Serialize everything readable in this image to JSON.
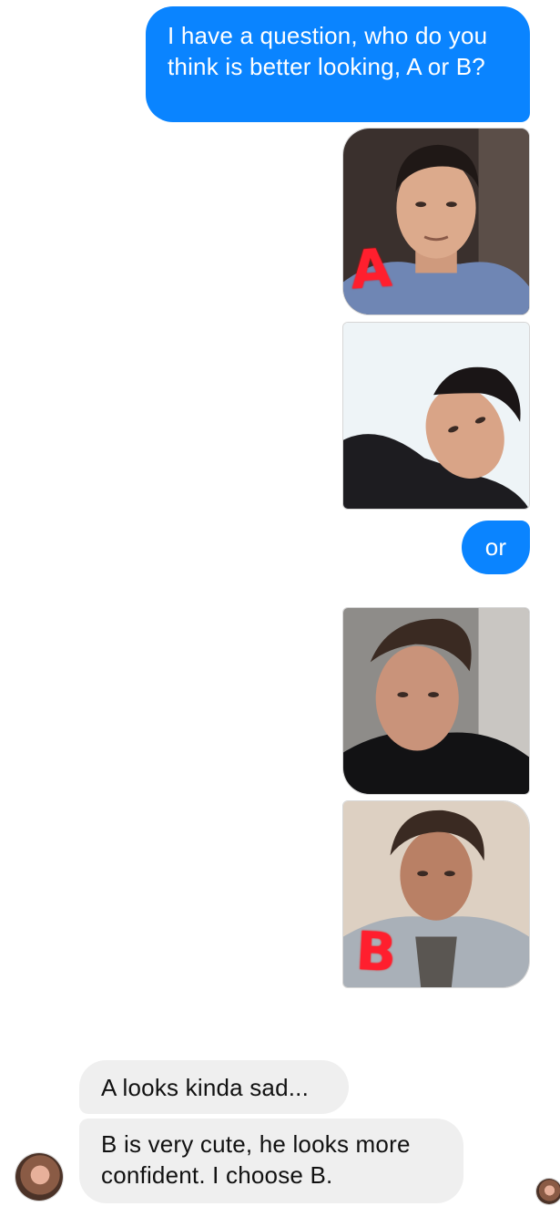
{
  "conversation": {
    "messages": [
      {
        "sender": "me",
        "type": "text",
        "text": "I have a question, who do you think is better looking, A or B?"
      },
      {
        "sender": "me",
        "type": "photo",
        "mark": "A"
      },
      {
        "sender": "me",
        "type": "photo",
        "mark": ""
      },
      {
        "sender": "me",
        "type": "text",
        "text": "or"
      },
      {
        "sender": "me",
        "type": "photo",
        "mark": ""
      },
      {
        "sender": "me",
        "type": "photo",
        "mark": "B"
      },
      {
        "sender": "contact",
        "type": "text",
        "text": "A looks kinda sad..."
      },
      {
        "sender": "contact",
        "type": "text",
        "text": "B is very cute, he looks more confident. I choose B."
      }
    ]
  },
  "colors": {
    "sent_bubble": "#0a84ff",
    "received_bubble": "#efefef",
    "photo_marker": "#ff1f2e"
  }
}
